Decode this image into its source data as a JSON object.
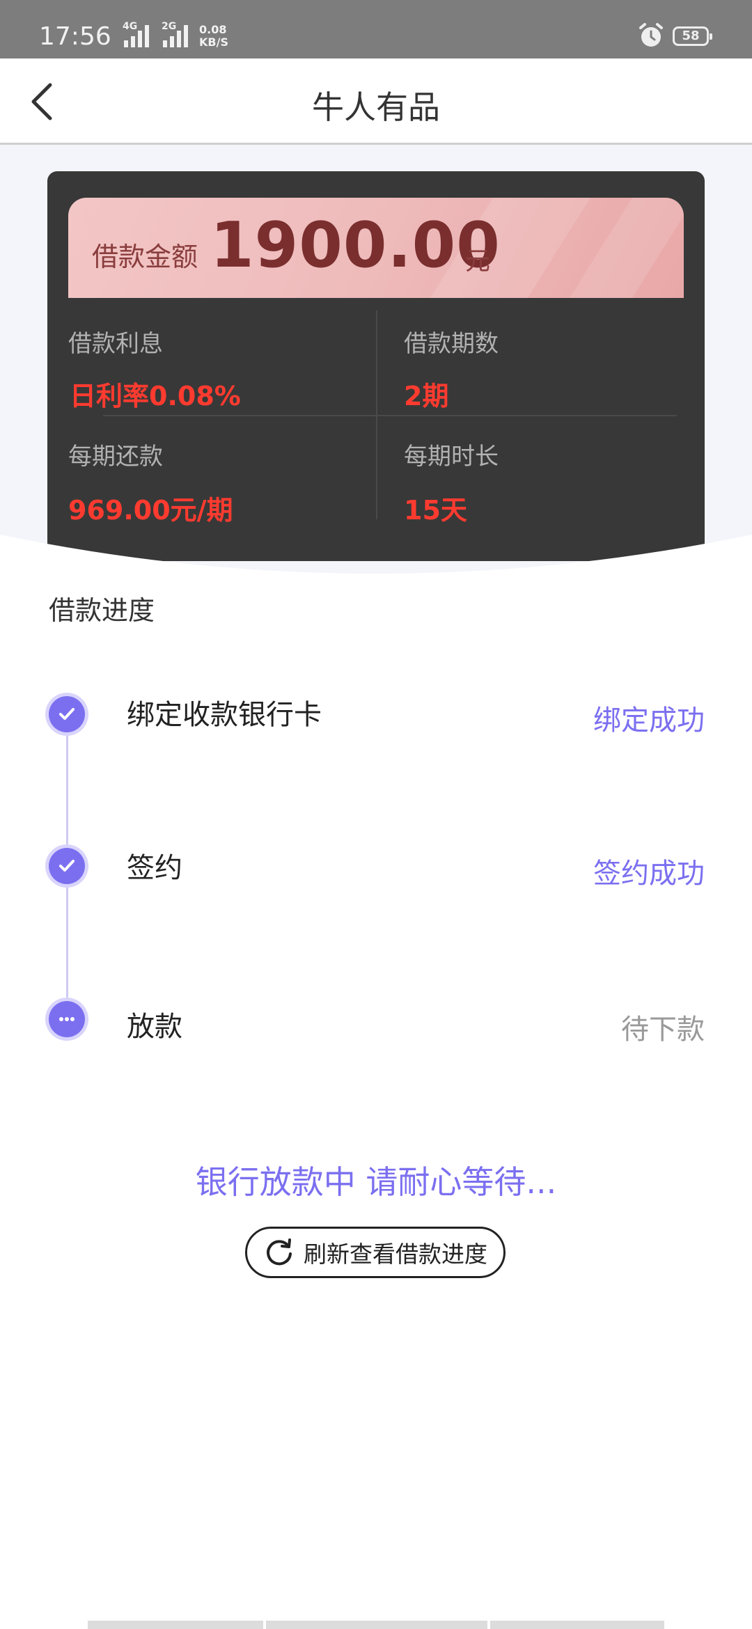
{
  "status_bar": {
    "time": "17:56",
    "signal1_tech": "4G",
    "signal2_tech": "2G",
    "net_speed_value": "0.08",
    "net_speed_unit": "KB/S",
    "battery": "58"
  },
  "header": {
    "title": "牛人有品"
  },
  "loan": {
    "amount_label": "借款金额",
    "amount": "1900.00",
    "amount_unit": "元",
    "interest_label": "借款利息",
    "interest_value": "日利率0.08%",
    "term_label": "借款期数",
    "term_value": "2期",
    "installment_label": "每期还款",
    "installment_value": "969.00元/期",
    "period_label": "每期时长",
    "period_value": "15天"
  },
  "progress": {
    "title": "借款进度",
    "steps": [
      {
        "name": "绑定收款银行卡",
        "status": "绑定成功"
      },
      {
        "name": "签约",
        "status": "签约成功"
      },
      {
        "name": "放款",
        "status": "待下款"
      }
    ]
  },
  "wait_message": "银行放款中 请耐心等待...",
  "refresh_button": "刷新查看借款进度",
  "colors": {
    "accent": "#7b6ff0",
    "card_bg": "#383838",
    "highlight_red": "#ff3b30",
    "amount_pink": "#efbcbc"
  }
}
